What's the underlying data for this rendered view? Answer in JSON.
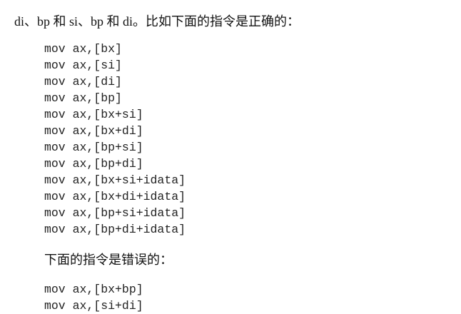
{
  "intro": "di、bp 和 si、bp 和 di。比如下面的指令是正确的：",
  "correct_instructions": [
    "mov ax,[bx]",
    "mov ax,[si]",
    "mov ax,[di]",
    "mov ax,[bp]",
    "mov ax,[bx+si]",
    "mov ax,[bx+di]",
    "mov ax,[bp+si]",
    "mov ax,[bp+di]",
    "mov ax,[bx+si+idata]",
    "mov ax,[bx+di+idata]",
    "mov ax,[bp+si+idata]",
    "mov ax,[bp+di+idata]"
  ],
  "wrong_heading": "下面的指令是错误的：",
  "wrong_instructions": [
    "mov ax,[bx+bp]",
    "mov ax,[si+di]"
  ]
}
